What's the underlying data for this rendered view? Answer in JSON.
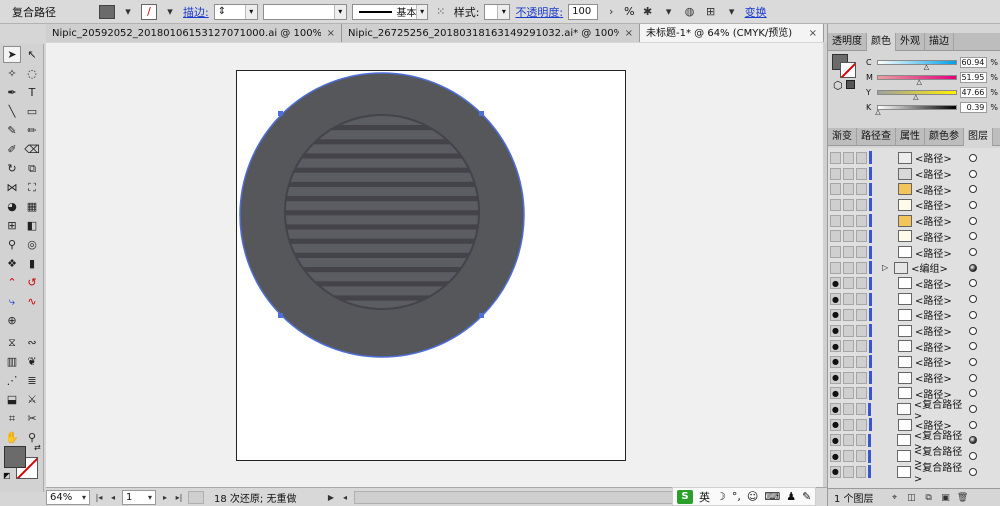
{
  "control_bar": {
    "selection_label": "复合路径",
    "stroke_label": "描边:",
    "stroke_profile": "基本",
    "style_label": "样式:",
    "opacity_label": "不透明度:",
    "opacity_value": "100",
    "opacity_unit": "%",
    "transform_label": "变换"
  },
  "doc_tabs": [
    {
      "label": "Nipic_20592052_20180106153127071000.ai @ 100% (RG...",
      "active": false
    },
    {
      "label": "Nipic_26725256_20180318163149291032.ai* @ 100% (R...",
      "active": false
    },
    {
      "label": "未标题-1* @ 64% (CMYK/预览)",
      "active": true
    }
  ],
  "tab_close": "×",
  "status_bar": {
    "zoom": "64%",
    "page": "1",
    "status_text": "18 次还原; 无重做"
  },
  "ime": {
    "logo": "S",
    "lang": "英"
  },
  "right_panel": {
    "top_tabs": [
      "透明度",
      "颜色",
      "外观",
      "描边"
    ],
    "active_top_tab": "颜色",
    "cmyk": [
      {
        "letter": "C",
        "value": "60.94"
      },
      {
        "letter": "M",
        "value": "51.95"
      },
      {
        "letter": "Y",
        "value": "47.66"
      },
      {
        "letter": "K",
        "value": "0.39"
      }
    ],
    "percent": "%",
    "layer_tabs": [
      "渐变",
      "路径查",
      "属性",
      "颜色参",
      "图层"
    ],
    "active_layer_tab": "图层",
    "layers": [
      {
        "name": "<路径>",
        "eye": false,
        "thumb": "#ededed",
        "target": "open"
      },
      {
        "name": "<路径>",
        "eye": false,
        "thumb": "#d9d9d9",
        "target": "open"
      },
      {
        "name": "<路径>",
        "eye": false,
        "thumb": "#f2c55c",
        "target": "open"
      },
      {
        "name": "<路径>",
        "eye": false,
        "thumb": "#fffbe8",
        "target": "open"
      },
      {
        "name": "<路径>",
        "eye": false,
        "thumb": "#f2c55c",
        "target": "open"
      },
      {
        "name": "<路径>",
        "eye": false,
        "thumb": "#fffbe8",
        "target": "open"
      },
      {
        "name": "<路径>",
        "eye": false,
        "thumb": "#ffffff",
        "target": "open"
      },
      {
        "name": "<编组>",
        "eye": false,
        "thumb": "#e6e6e6",
        "target": "filled"
      },
      {
        "name": "<路径>",
        "eye": true,
        "thumb": "#ffffff",
        "target": "open"
      },
      {
        "name": "<路径>",
        "eye": true,
        "thumb": "#ffffff",
        "target": "open"
      },
      {
        "name": "<路径>",
        "eye": true,
        "thumb": "#ffffff",
        "target": "open"
      },
      {
        "name": "<路径>",
        "eye": true,
        "thumb": "#ffffff",
        "target": "open"
      },
      {
        "name": "<路径>",
        "eye": true,
        "thumb": "#ffffff",
        "target": "open"
      },
      {
        "name": "<路径>",
        "eye": true,
        "thumb": "#ffffff",
        "target": "open"
      },
      {
        "name": "<路径>",
        "eye": true,
        "thumb": "#ffffff",
        "target": "open"
      },
      {
        "name": "<路径>",
        "eye": true,
        "thumb": "#ffffff",
        "target": "open"
      },
      {
        "name": "<复合路径>",
        "eye": true,
        "thumb": "#ffffff",
        "target": "open"
      },
      {
        "name": "<路径>",
        "eye": true,
        "thumb": "#ffffff",
        "target": "open"
      },
      {
        "name": "<复合路径>",
        "eye": true,
        "thumb": "#ffffff",
        "target": "filled"
      },
      {
        "name": "<复合路径>",
        "eye": true,
        "thumb": "#ffffff",
        "target": "open"
      },
      {
        "name": "<复合路径>",
        "eye": true,
        "thumb": "#ffffff",
        "target": "open"
      }
    ],
    "layer_count": "1 个图层"
  },
  "colors": {
    "outer_ring": "#55575a",
    "inner_disk": "#4a4b52",
    "stripe_light": "#5c5d63",
    "stripe_dark": "#3f4047",
    "selection": "#4f6fd8",
    "fill_swatch": "#6b6b6b"
  }
}
